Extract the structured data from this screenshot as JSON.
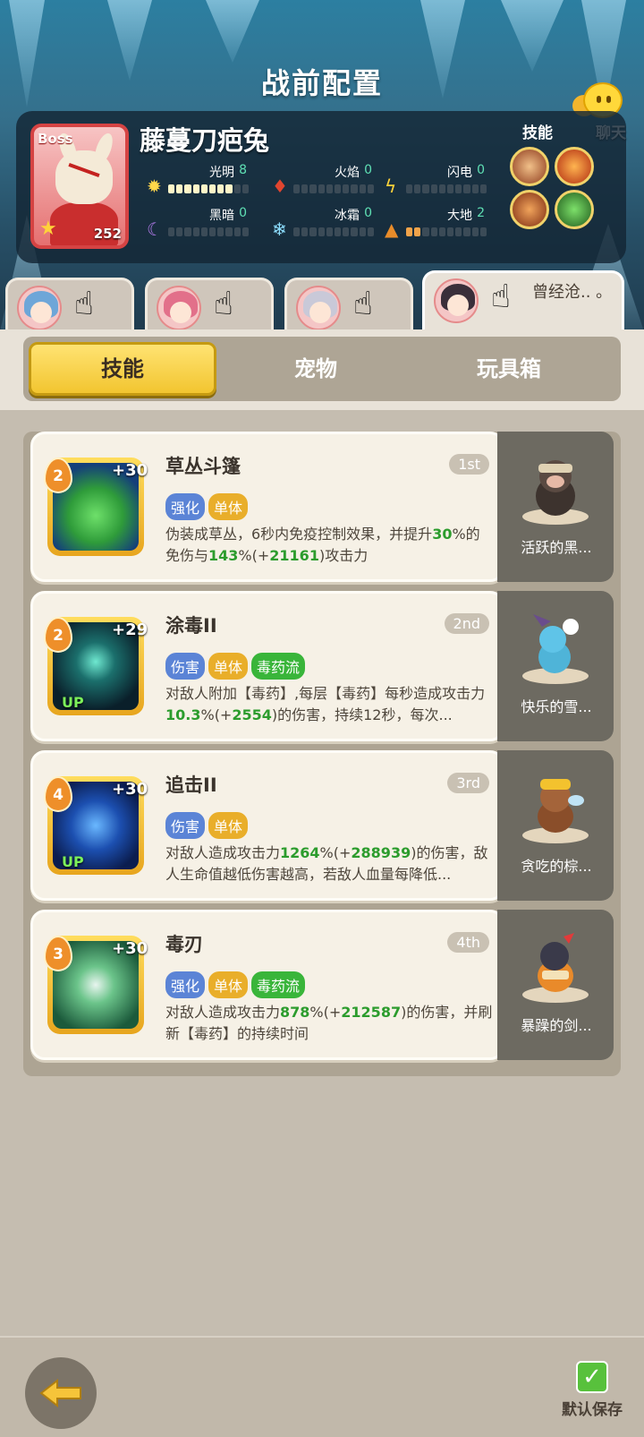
{
  "header": {
    "title": "战前配置",
    "chat_label": "聊天"
  },
  "boss": {
    "tag": "Boss",
    "name": "藤蔓刀疤兔",
    "level": "252",
    "skills_label": "技能",
    "stats": [
      {
        "label": "光明",
        "value": "8",
        "filled": 8,
        "icon": "sun-icon"
      },
      {
        "label": "火焰",
        "value": "0",
        "filled": 0,
        "icon": "fire-icon"
      },
      {
        "label": "闪电",
        "value": "0",
        "filled": 0,
        "icon": "lightning-icon"
      },
      {
        "label": "黑暗",
        "value": "0",
        "filled": 0,
        "icon": "moon-icon"
      },
      {
        "label": "冰霜",
        "value": "0",
        "filled": 0,
        "icon": "snowflake-icon"
      },
      {
        "label": "大地",
        "value": "2",
        "filled": 2,
        "icon": "earth-icon"
      }
    ]
  },
  "team": {
    "tabs": [
      {
        "name": ""
      },
      {
        "name": ""
      },
      {
        "name": ""
      },
      {
        "name": "曾经沧.. 。"
      }
    ]
  },
  "subtabs": [
    "技能",
    "宠物",
    "玩具箱"
  ],
  "skills": [
    {
      "name": "草丛斗篷",
      "rank": "1st",
      "level": "2",
      "plus": "+30",
      "up": "",
      "tags": [
        {
          "text": "强化",
          "color": "blue"
        },
        {
          "text": "单体",
          "color": "orange"
        }
      ],
      "desc_parts": [
        "伪装成草丛，6秒内免疫控制效果，并提升",
        "30",
        "%的免伤与",
        "143",
        "%(+",
        "21161",
        ")攻击力"
      ],
      "pet_name": "活跃的黑..."
    },
    {
      "name": "涂毒II",
      "rank": "2nd",
      "level": "2",
      "plus": "+29",
      "up": "UP",
      "tags": [
        {
          "text": "伤害",
          "color": "blue"
        },
        {
          "text": "单体",
          "color": "orange"
        },
        {
          "text": "毒药流",
          "color": "green"
        }
      ],
      "desc_parts": [
        "对敌人附加【毒药】,每层【毒药】每秒造成攻击力",
        "10.3",
        "%(+",
        "2554",
        ")的伤害，持续12秒，每次..."
      ],
      "pet_name": "快乐的雪..."
    },
    {
      "name": "追击II",
      "rank": "3rd",
      "level": "4",
      "plus": "+30",
      "up": "UP",
      "tags": [
        {
          "text": "伤害",
          "color": "blue"
        },
        {
          "text": "单体",
          "color": "orange"
        }
      ],
      "desc_parts": [
        "对敌人造成攻击力",
        "1264",
        "%(+",
        "288939",
        ")的伤害，敌人生命值越低伤害越高，若敌人血量每降低..."
      ],
      "pet_name": "贪吃的棕..."
    },
    {
      "name": "毒刃",
      "rank": "4th",
      "level": "3",
      "plus": "+30",
      "up": "",
      "tags": [
        {
          "text": "强化",
          "color": "blue"
        },
        {
          "text": "单体",
          "color": "orange"
        },
        {
          "text": "毒药流",
          "color": "green"
        }
      ],
      "desc_parts": [
        "对敌人造成攻击力",
        "878",
        "%(+",
        "212587",
        ")的伤害，并刷新【毒药】的持续时间"
      ],
      "pet_name": "暴躁的剑..."
    }
  ],
  "bottom": {
    "save_label": "默认保存"
  },
  "colors": {
    "accent_yellow": "#f2c530",
    "highlight_green": "#2c9c2d",
    "boss_red": "#d54343"
  }
}
